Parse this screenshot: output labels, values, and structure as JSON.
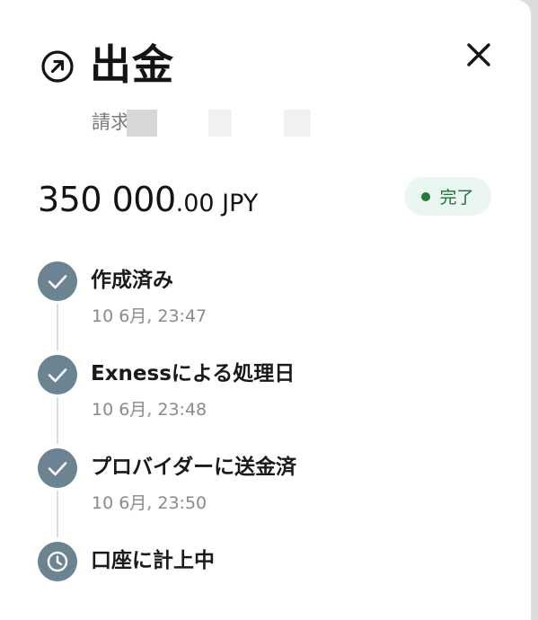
{
  "header": {
    "title": "出金",
    "subtitle": "請求",
    "icon": "arrow-up-right-circle-icon",
    "close_icon": "close-icon"
  },
  "amount": {
    "integer_part": "350 000",
    "decimal_part": ".00 JPY"
  },
  "status": {
    "label": "完了",
    "color": "#1f7a3c",
    "background": "#eaf6ef"
  },
  "timeline": {
    "icon_color": "#6c8392",
    "steps": [
      {
        "title": "作成済み",
        "time": "10 6月, 23:47",
        "icon": "check-icon"
      },
      {
        "title": "Exnessによる処理日",
        "time": "10 6月, 23:48",
        "icon": "check-icon"
      },
      {
        "title": "プロバイダーに送金済",
        "time": "10 6月, 23:50",
        "icon": "check-icon"
      },
      {
        "title": "口座に計上中",
        "icon": "clock-icon"
      }
    ]
  }
}
